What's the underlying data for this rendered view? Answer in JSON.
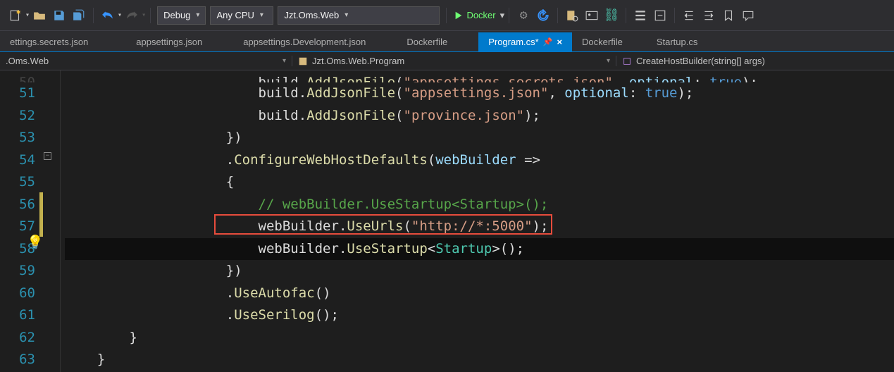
{
  "toolbar": {
    "config": "Debug",
    "platform": "Any CPU",
    "project": "Jzt.Oms.Web",
    "run_target": "Docker"
  },
  "tabs": [
    {
      "label": "ettings.secrets.json"
    },
    {
      "label": "appsettings.json"
    },
    {
      "label": "appsettings.Development.json"
    },
    {
      "label": "Dockerfile"
    },
    {
      "label": "Program.cs*",
      "active": true
    },
    {
      "label": "Dockerfile"
    },
    {
      "label": "Startup.cs"
    }
  ],
  "navbar": {
    "left": ".Oms.Web",
    "mid": "Jzt.Oms.Web.Program",
    "right": "CreateHostBuilder(string[] args)"
  },
  "line_numbers": [
    "51",
    "52",
    "53",
    "54",
    "55",
    "56",
    "57",
    "58",
    "59",
    "60",
    "61",
    "62",
    "63"
  ],
  "code": {
    "l0_id": "build",
    "l0_m": "AddJsonFile",
    "l0_s1": "\"appsettings.secrets.json\"",
    "l0_k": "optional",
    "l0_v": "true",
    "l1_id": "build",
    "l1_m": "AddJsonFile",
    "l1_s1": "\"appsettings.json\"",
    "l1_k": "optional",
    "l1_v": "true",
    "l2_id": "build",
    "l2_m": "AddJsonFile",
    "l2_s1": "\"province.json\"",
    "l3": "})",
    "l4_m": "ConfigureWebHostDefaults",
    "l4_p": "webBuilder",
    "l5": "{",
    "l6_com": "// webBuilder.UseStartup<Startup>();",
    "l7_id": "webBuilder",
    "l7_m": "UseUrls",
    "l7_s": "\"http://*:5000\"",
    "l8_id": "webBuilder",
    "l8_m": "UseStartup",
    "l8_cls": "Startup",
    "l9": "})",
    "l10_m": "UseAutofac",
    "l11_m": "UseSerilog",
    "l12": "}",
    "l13": "}"
  }
}
